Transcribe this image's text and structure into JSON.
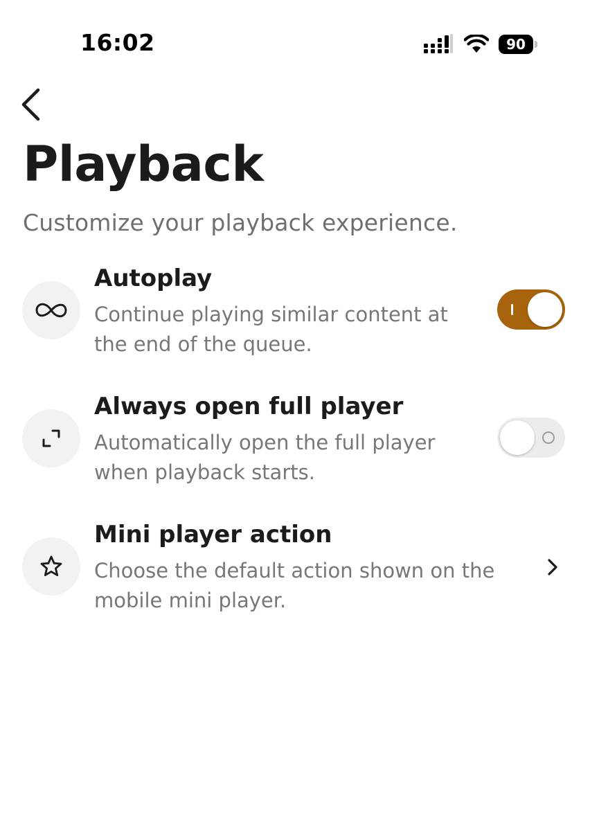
{
  "status_bar": {
    "time": "16:02",
    "battery_level": "90",
    "icons": [
      "signal-icon",
      "wifi-icon",
      "battery-icon"
    ]
  },
  "header": {
    "back_icon": "chevron-left-icon",
    "title": "Playback",
    "subtitle": "Customize your playback experience."
  },
  "settings": [
    {
      "icon": "infinity-icon",
      "title": "Autoplay",
      "description": "Continue playing similar content at the end of the queue.",
      "control": "toggle",
      "enabled": true
    },
    {
      "icon": "expand-icon",
      "title": "Always open full player",
      "description": "Automatically open the full player when playback starts.",
      "control": "toggle",
      "enabled": false
    },
    {
      "icon": "star-icon",
      "title": "Mini player action",
      "description": "Choose the default action shown on the mobile mini player.",
      "control": "chevron-right-icon"
    }
  ],
  "colors": {
    "toggle_on": "#a8640c",
    "toggle_off": "#ececec",
    "title_text": "#1b1b1b",
    "secondary_text": "#777777",
    "icon_circle": "#f2f2f2"
  }
}
